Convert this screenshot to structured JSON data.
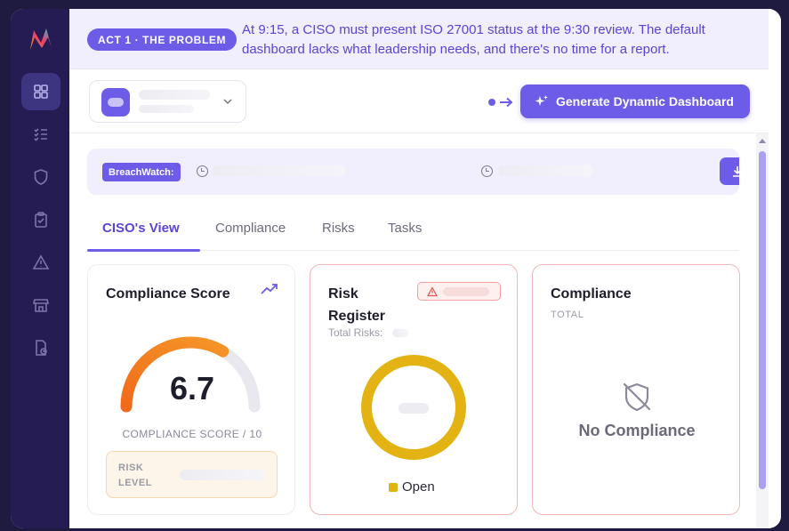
{
  "banner": {
    "act_label": "ACT 1 · THE PROBLEM",
    "message": "At 9:15, a CISO must present ISO 27001 status at the 9:30 review. The default dashboard lacks what leadership needs, and there's no time for a report."
  },
  "sidebar": {
    "items": [
      {
        "icon": "dashboard-icon",
        "active": true
      },
      {
        "icon": "checklist-icon",
        "active": false
      },
      {
        "icon": "shield-icon",
        "active": false
      },
      {
        "icon": "clipboard-check-icon",
        "active": false
      },
      {
        "icon": "warning-icon",
        "active": false
      },
      {
        "icon": "store-icon",
        "active": false
      },
      {
        "icon": "report-file-icon",
        "active": false
      }
    ]
  },
  "toolbar": {
    "generate_label": "Generate Dynamic Dashboard"
  },
  "strip": {
    "badge": "BreachWatch:"
  },
  "tabs": [
    {
      "label": "CISO's View",
      "active": true
    },
    {
      "label": "Compliance",
      "active": false
    },
    {
      "label": "Risks",
      "active": false
    },
    {
      "label": "Tasks",
      "active": false
    }
  ],
  "cards": {
    "compliance_score": {
      "title": "Compliance Score",
      "value": "6.7",
      "fraction": 0.67,
      "caption": "COMPLIANCE SCORE / 10",
      "risk_level_label": "RISK LEVEL"
    },
    "risk_register": {
      "title": "Risk Register",
      "subtitle": "Total Risks:",
      "legend": "Open"
    },
    "compliance": {
      "title": "Compliance",
      "subtitle": "TOTAL",
      "empty_text": "No Compliance"
    }
  },
  "colors": {
    "brand": "#6c5ce7",
    "sidebar": "#241c52",
    "gauge_start": "#f06a1a",
    "gauge_end": "#f59b2a",
    "open_status": "#e2b312"
  }
}
